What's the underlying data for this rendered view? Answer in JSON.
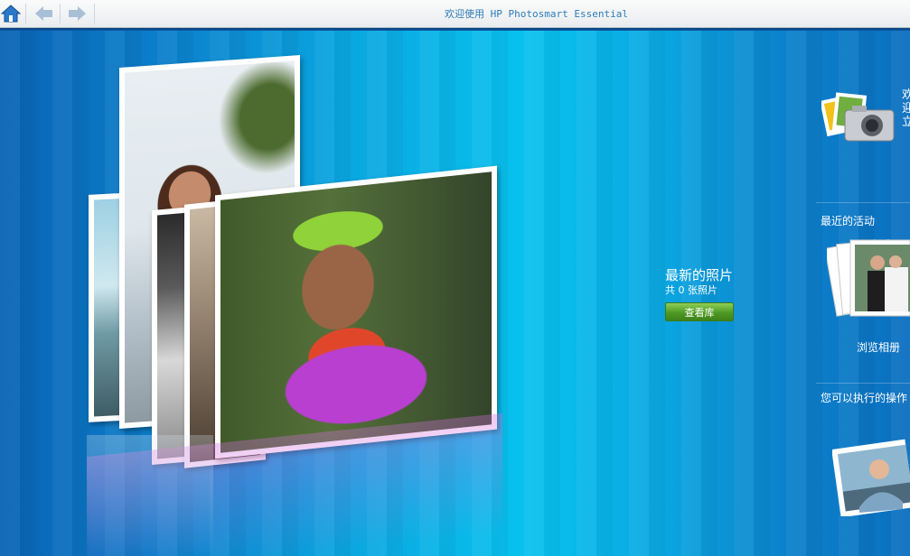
{
  "window": {
    "title": "欢迎使用 HP Photosmart Essential"
  },
  "toolbar": {
    "home_icon": "home-icon",
    "back_icon": "arrow-left-icon",
    "forward_icon": "arrow-right-icon"
  },
  "main": {
    "latest_title": "最新的照片",
    "photo_count_label": "共 0 张照片",
    "view_library_button": "查看库"
  },
  "sidebar": {
    "welcome_text": "欢迎立",
    "recent_activity_heading": "最近的活动",
    "browse_album_label": "浏览相册",
    "actions_heading": "您可以执行的操作"
  },
  "colors": {
    "accent_title": "#2e7db8",
    "background_blue": "#0a8fd6",
    "button_green": "#4e9a25"
  }
}
